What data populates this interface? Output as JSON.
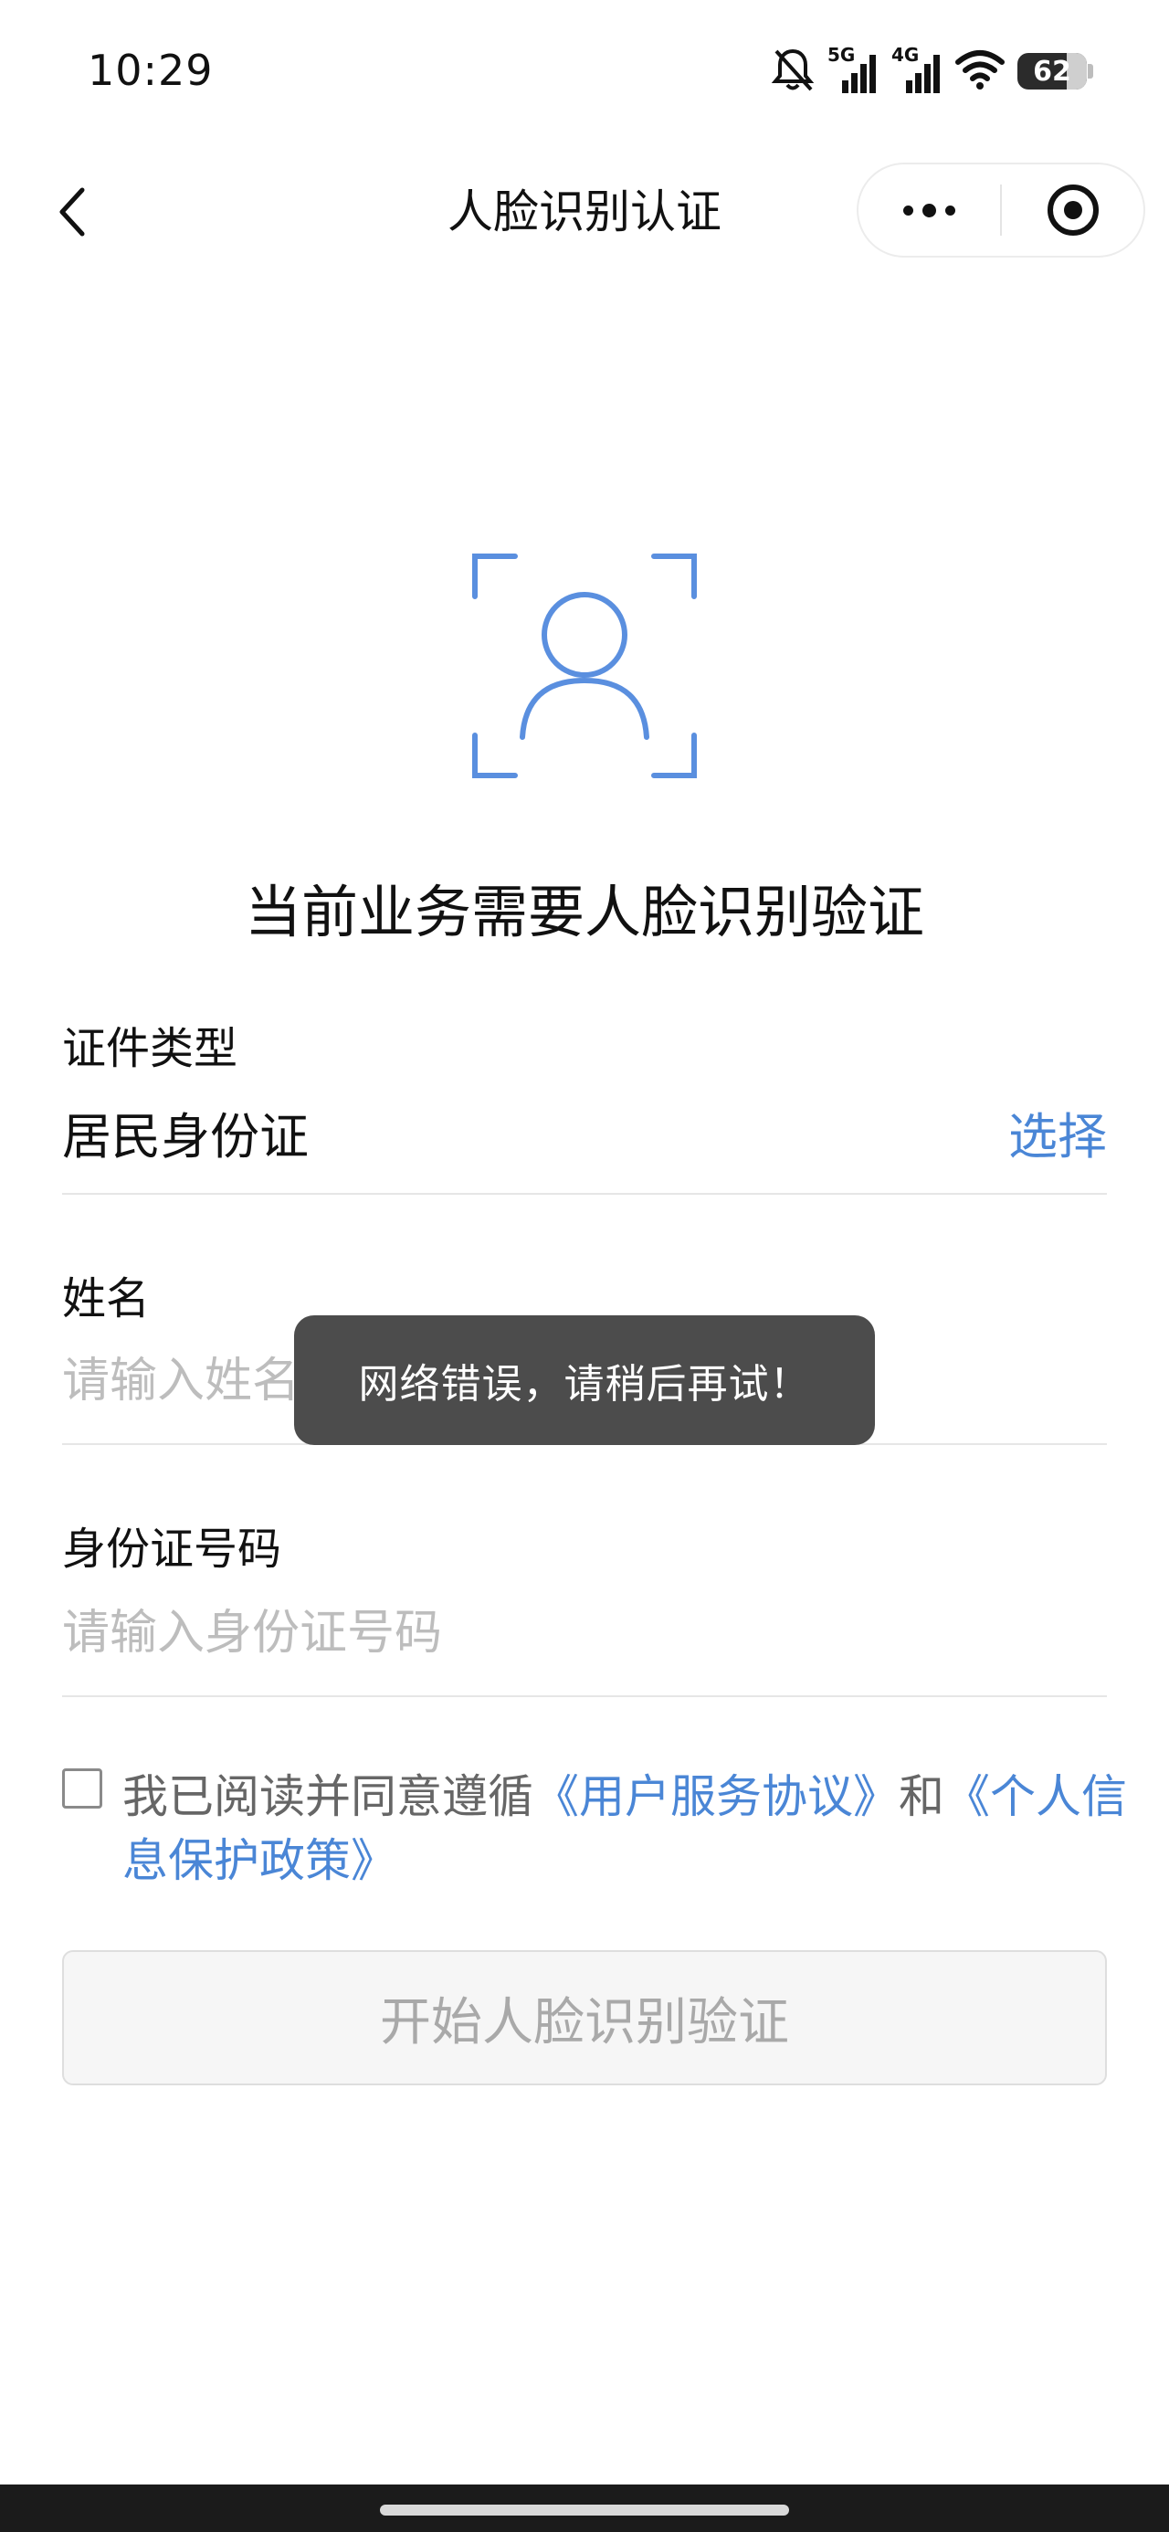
{
  "status_bar": {
    "time": "10:29",
    "signal_1_label": "5G",
    "signal_2_label": "4G",
    "battery": "62",
    "icons": [
      "bell-muted-icon",
      "signal-5g-icon",
      "signal-4g-icon",
      "wifi-icon",
      "battery-icon"
    ]
  },
  "nav": {
    "title": "人脸识别认证",
    "back_icon": "chevron-left-icon",
    "more_icon": "more-dots-icon",
    "close_icon": "target-circle-icon"
  },
  "main": {
    "face_icon": "face-scan-icon",
    "headline": "当前业务需要人脸识别验证",
    "accent_color": "#4a86d6",
    "id_type": {
      "label": "证件类型",
      "value": "居民身份证",
      "action": "选择"
    },
    "name": {
      "label": "姓名",
      "placeholder": "请输入姓名"
    },
    "id_number": {
      "label": "身份证号码",
      "placeholder": "请输入身份证号码"
    },
    "agreement": {
      "prefix": "我已阅读并同意遵循",
      "link1": "《用户服务协议》",
      "middle": "和",
      "link2": "《个人信息保护政策》"
    },
    "start_button": "开始人脸识别验证"
  },
  "toast": {
    "message": "网络错误，请稍后再试！"
  }
}
